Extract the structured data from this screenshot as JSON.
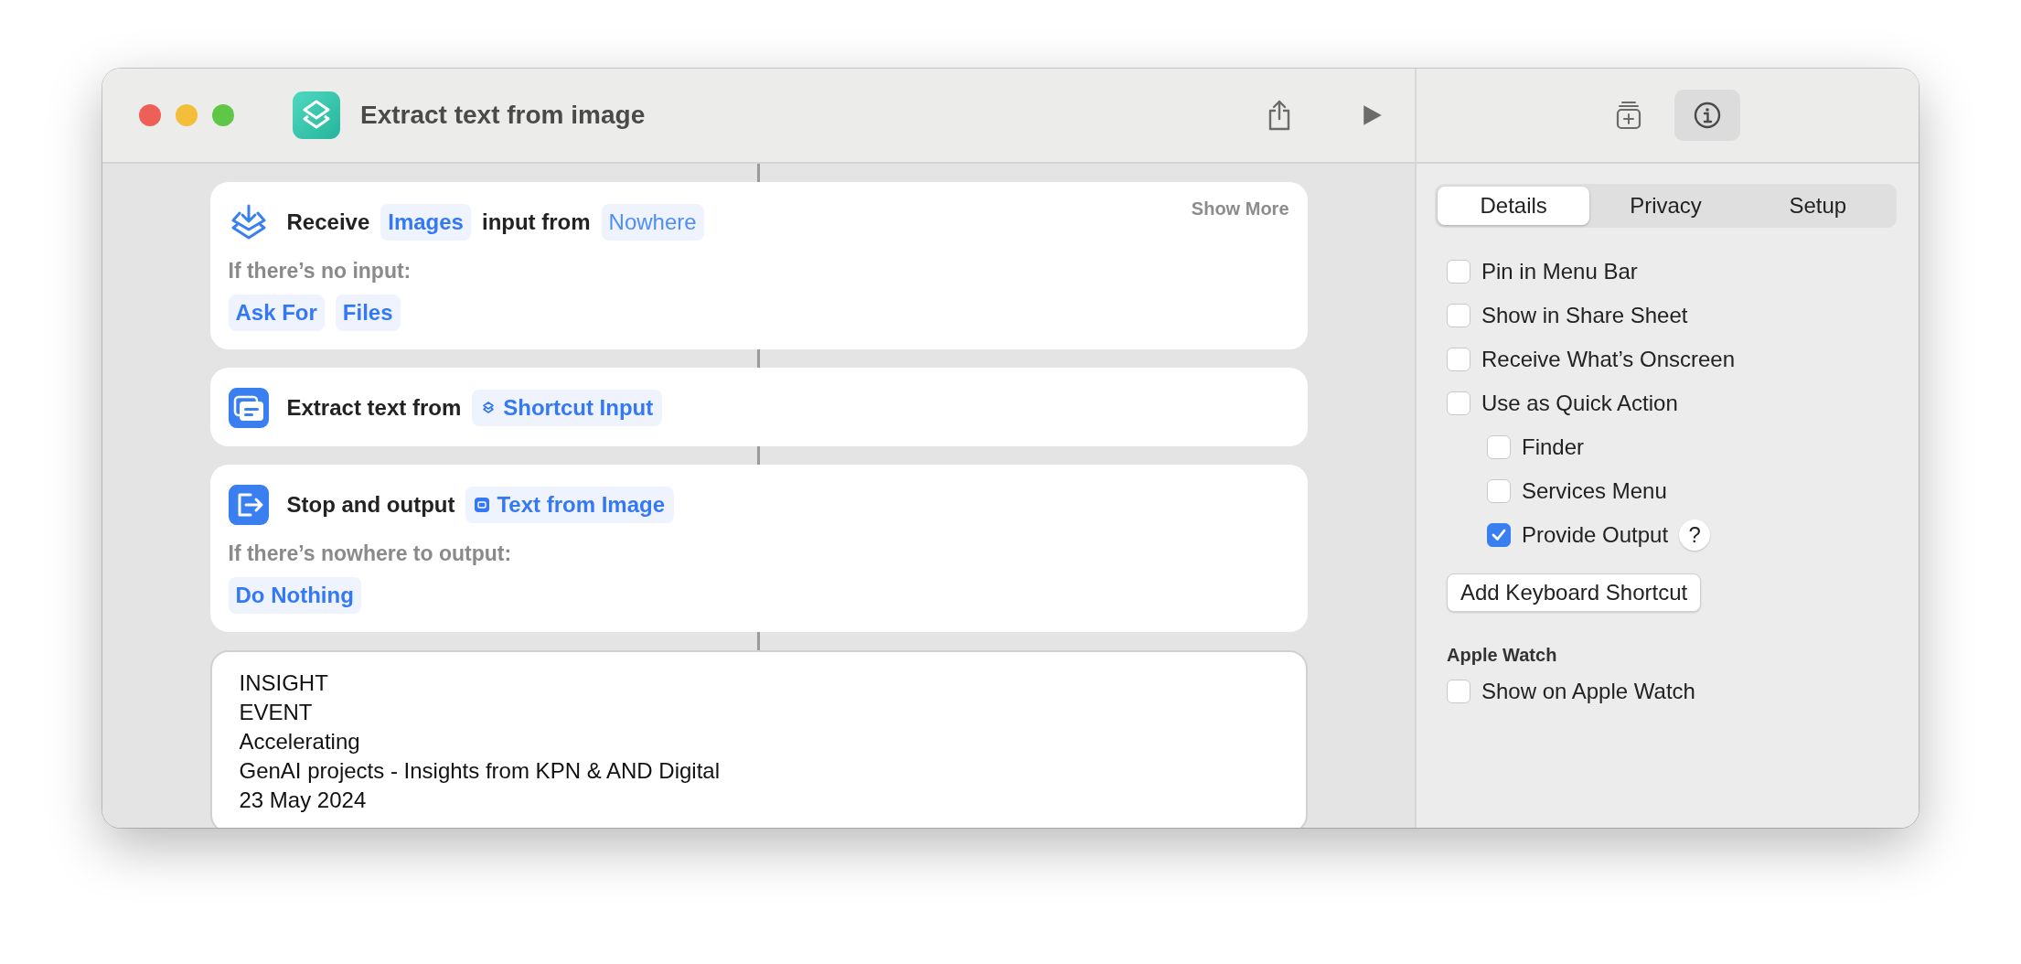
{
  "window": {
    "title": "Extract text from image"
  },
  "inspector_tools": [
    {
      "kind": "library",
      "selected": false
    },
    {
      "kind": "info",
      "selected": true
    }
  ],
  "actions": [
    {
      "kind": "receive",
      "show_more": "Show More",
      "parts": [
        {
          "kind": "text",
          "text": "Receive"
        },
        {
          "kind": "token",
          "text": "Images",
          "placeholder": false
        },
        {
          "kind": "text",
          "text": "input from"
        },
        {
          "kind": "token",
          "text": "Nowhere",
          "placeholder": true
        }
      ],
      "fallback": {
        "label": "If there’s no input:",
        "options": [
          "Ask For",
          "Files"
        ]
      }
    },
    {
      "kind": "extract_text",
      "parts": [
        {
          "kind": "text",
          "text": "Extract text from"
        },
        {
          "kind": "input_variable",
          "text": "Shortcut Input",
          "placeholder": false
        }
      ]
    },
    {
      "kind": "stop_output",
      "parts": [
        {
          "kind": "text",
          "text": "Stop and output"
        },
        {
          "kind": "output_variable",
          "text": "Text from Image",
          "placeholder": false
        }
      ],
      "fallback": {
        "label": "If there’s nowhere to output:",
        "options": [
          "Do Nothing"
        ]
      }
    }
  ],
  "result": {
    "lines": [
      "INSIGHT",
      "EVENT",
      "Accelerating",
      "GenAI projects - Insights from KPN & AND Digital",
      "23 May 2024"
    ]
  },
  "inspector": {
    "tabs": [
      {
        "label": "Details",
        "selected": true
      },
      {
        "label": "Privacy",
        "selected": false
      },
      {
        "label": "Setup",
        "selected": false
      }
    ],
    "options": [
      {
        "label": "Pin in Menu Bar",
        "checked": false
      },
      {
        "label": "Show in Share Sheet",
        "checked": false
      },
      {
        "label": "Receive What’s Onscreen",
        "checked": false
      },
      {
        "label": "Use as Quick Action",
        "checked": false,
        "children": [
          {
            "label": "Finder",
            "checked": false
          },
          {
            "label": "Services Menu",
            "checked": false
          },
          {
            "label": "Provide Output",
            "checked": true,
            "help": "?"
          }
        ]
      }
    ],
    "shortcut_button": "Add Keyboard Shortcut",
    "apple_watch": {
      "heading": "Apple Watch",
      "options": [
        {
          "label": "Show on Apple Watch",
          "checked": false
        }
      ]
    }
  }
}
